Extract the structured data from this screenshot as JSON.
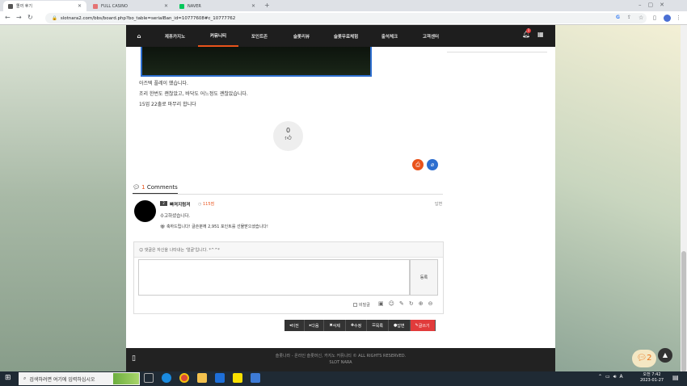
{
  "browser": {
    "tabs": [
      {
        "title": "똘끼 후기",
        "active": true
      },
      {
        "title": "FULL CASINO",
        "active": false
      },
      {
        "title": "NAVER",
        "active": false
      }
    ],
    "new_tab": "+",
    "url": "slotnara2.com/bbs/board.php?bo_table=serialBan_id=10777608#c_10777762"
  },
  "gnb": {
    "home_icon": "home-icon",
    "items": [
      "제휴카지노",
      "커뮤니티",
      "포인트존",
      "슬롯리뷰",
      "슬롯무료체험",
      "출석체크",
      "고객센터"
    ],
    "active_index": 1,
    "bell_badge": "1"
  },
  "post": {
    "lines": [
      "아즈텍 플레이 했습니다.",
      "조리 한번도 괜찮았고, 바닥도 어느정도 괜찮았습니다.",
      "15업 22출로 마무리 합니다"
    ],
    "like_count": "0"
  },
  "comments": {
    "count": "1",
    "label": "Comments",
    "items": [
      {
        "level": "2",
        "author": "빠져지럼져",
        "points": "115점",
        "action": "답변",
        "text": "수고하셨습니다.",
        "reward": "축하드립니다! 글쓴분께 2,951 포인트를 선물받으셨습니다!"
      }
    ]
  },
  "comment_form": {
    "notice": "댓글은 자신을 나타내는 '얼굴'입니다. *^^*",
    "submit_label": "등록",
    "secret_label": "비밀글"
  },
  "buttons": [
    "이전",
    "다음",
    "삭제",
    "수정",
    "목록",
    "답변",
    "글쓰기"
  ],
  "footer": {
    "line1": "슬롯나라 - 온라인 슬롯머신, 카지노 커뮤니티 © ALL RIGHTS RESERVED.",
    "line2": "SLOT NARA"
  },
  "chat_badge": "2",
  "taskbar": {
    "search_placeholder": "검색하려면 여기에 입력하십시오",
    "time": "오전 7:42",
    "date": "2023-01-27"
  },
  "colors": {
    "accent": "#e9531b",
    "button_red": "#e13b3b",
    "link_blue": "#2d6ecf"
  }
}
